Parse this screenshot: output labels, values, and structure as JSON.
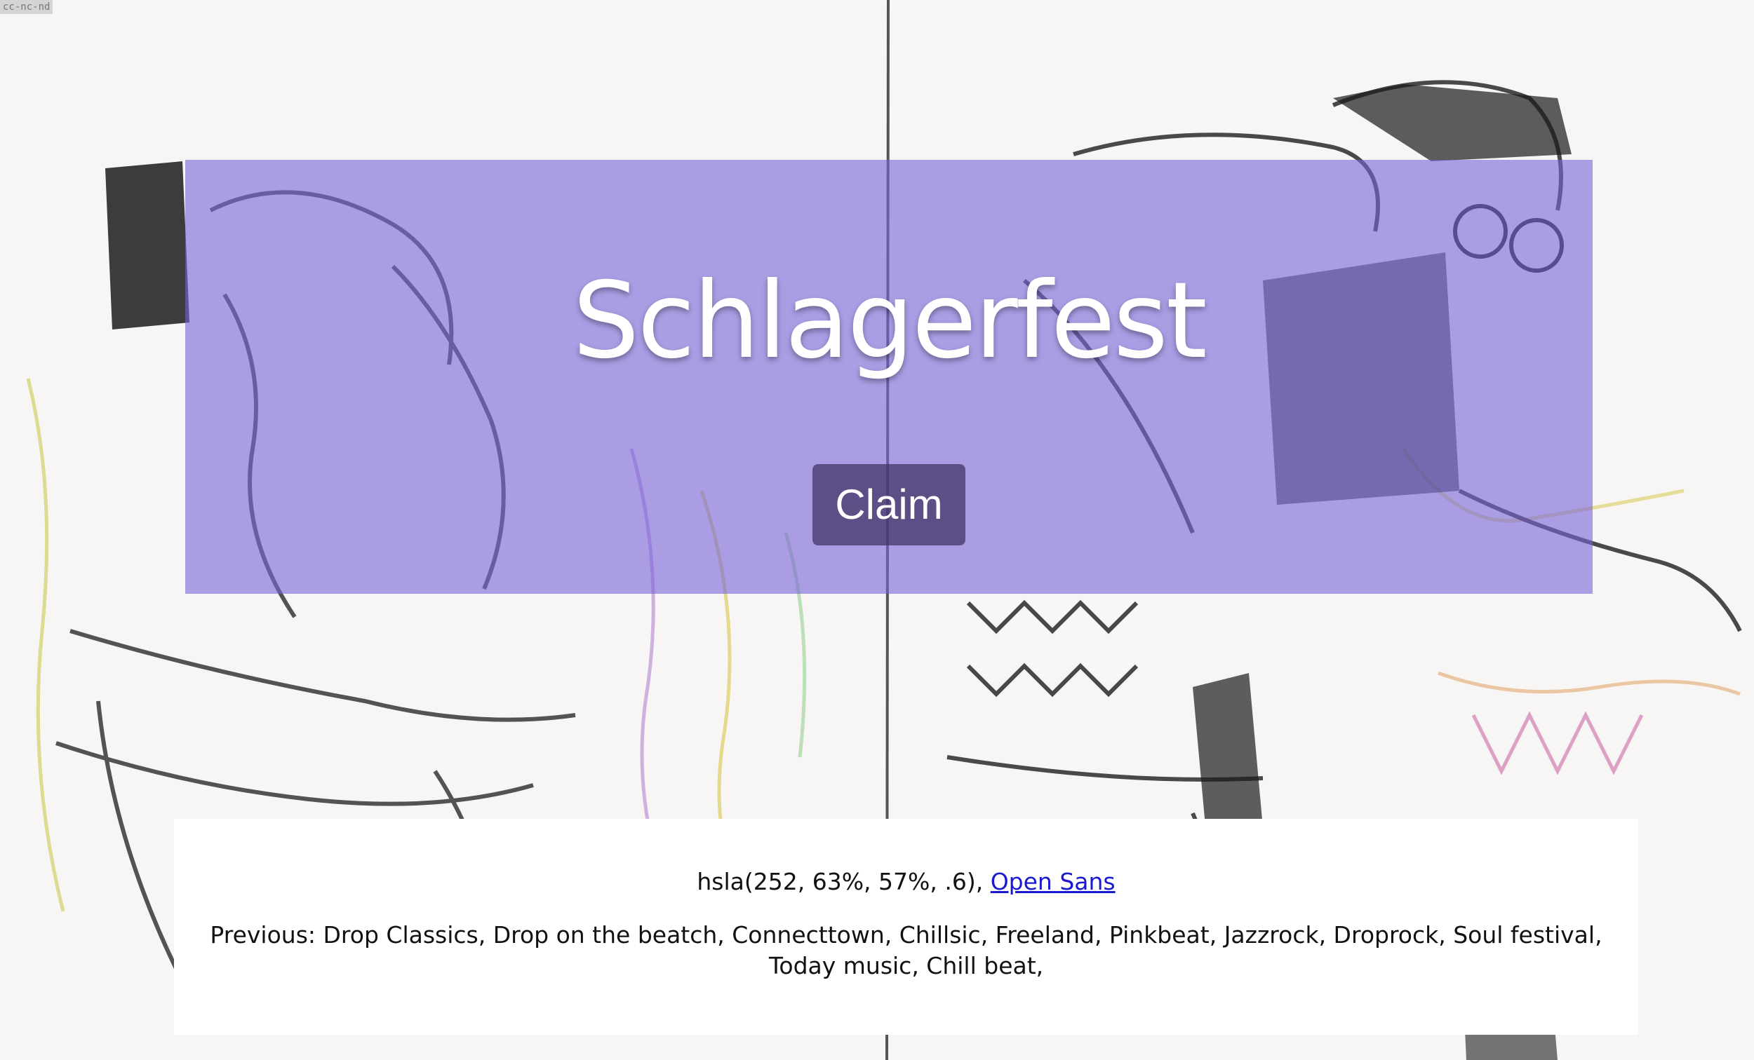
{
  "license": "cc-nc-nd",
  "hero": {
    "title": "Schlagerfest",
    "claim_label": "Claim",
    "overlay_color": "hsla(252, 63%, 57%, .6)"
  },
  "info": {
    "color_text": "hsla(252, 63%, 57%, .6),",
    "font_link": "Open Sans",
    "previous_prefix": "Previous:",
    "previous_list": [
      "Drop Classics",
      "Drop on the beatch",
      "Connecttown",
      "Chillsic",
      "Freeland",
      "Pinkbeat",
      "Jazzrock",
      "Droprock",
      "Soul festival",
      "Today music",
      "Chill beat"
    ]
  },
  "background": {
    "description_icon": "sketch-illustration-image"
  }
}
